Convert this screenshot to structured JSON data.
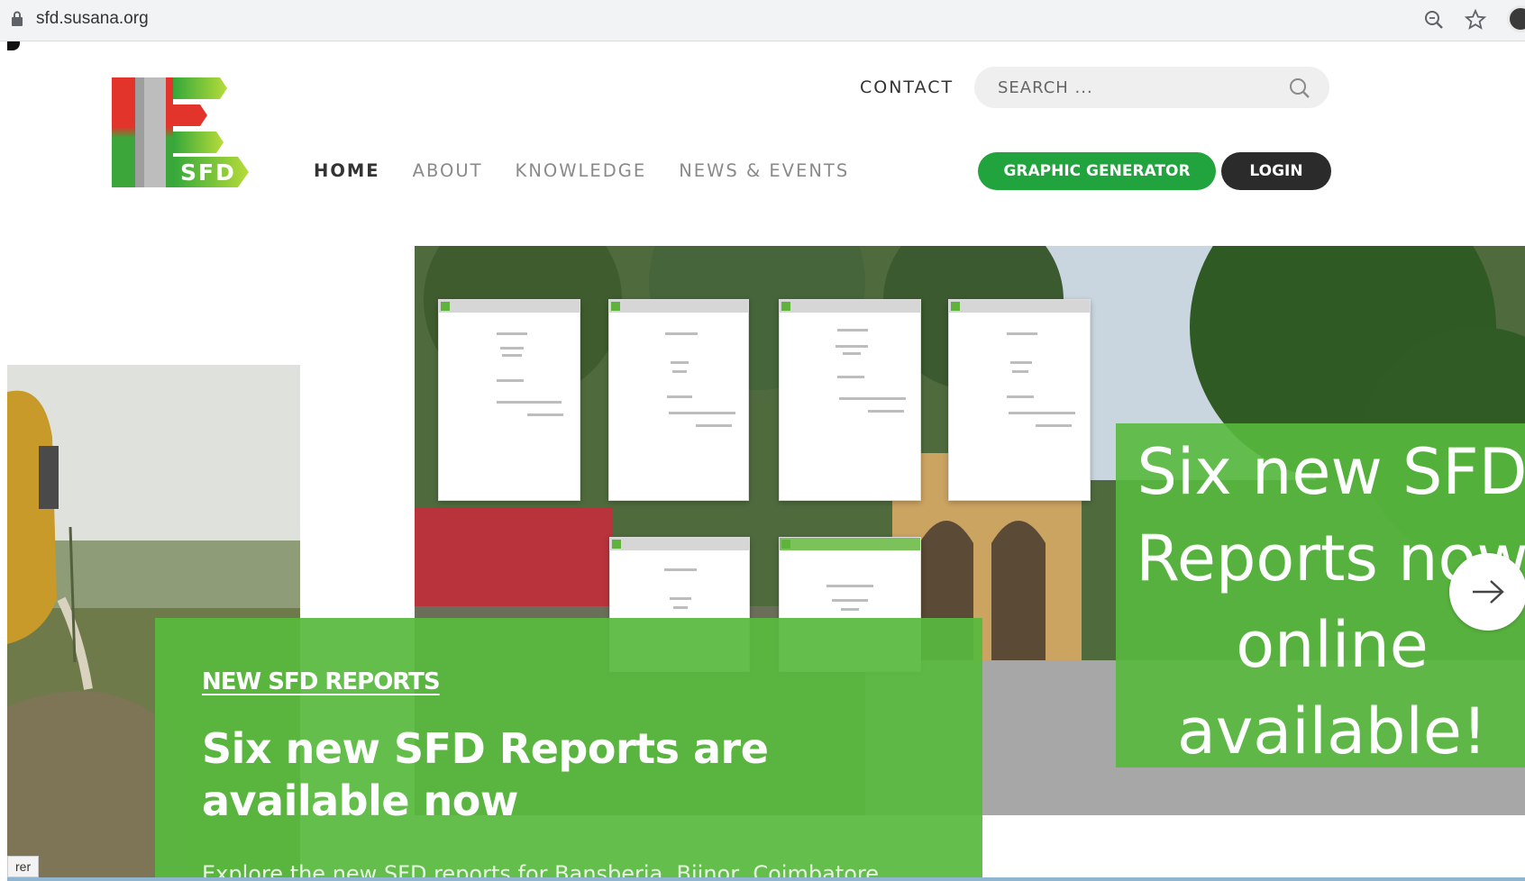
{
  "browser": {
    "url": "sfd.susana.org",
    "icons": [
      "lock-icon",
      "zoom-icon",
      "star-icon",
      "profile-icon"
    ]
  },
  "header": {
    "logo_text": "SFD",
    "contact_label": "CONTACT",
    "search_placeholder": "SEARCH ...",
    "nav": [
      {
        "label": "HOME",
        "active": true
      },
      {
        "label": "ABOUT",
        "active": false
      },
      {
        "label": "KNOWLEDGE",
        "active": false
      },
      {
        "label": "NEWS & EVENTS",
        "active": false
      }
    ],
    "graphic_generator_label": "GRAPHIC GENERATOR",
    "login_label": "LOGIN"
  },
  "hero": {
    "kicker": "NEW SFD REPORTS",
    "title": "Six new SFD Reports are available now",
    "description": "Explore the new SFD reports for Bansberia, Bijnor, Coimbatore",
    "promo_text": "Six new SFD Reports now online available!",
    "next_icon": "arrow-right-icon"
  },
  "status_tip": "rer",
  "colors": {
    "brand_green": "#21a33d",
    "overlay_green": "#58b93e",
    "login_dark": "#2b2b2b",
    "logo_red": "#e2342b"
  }
}
